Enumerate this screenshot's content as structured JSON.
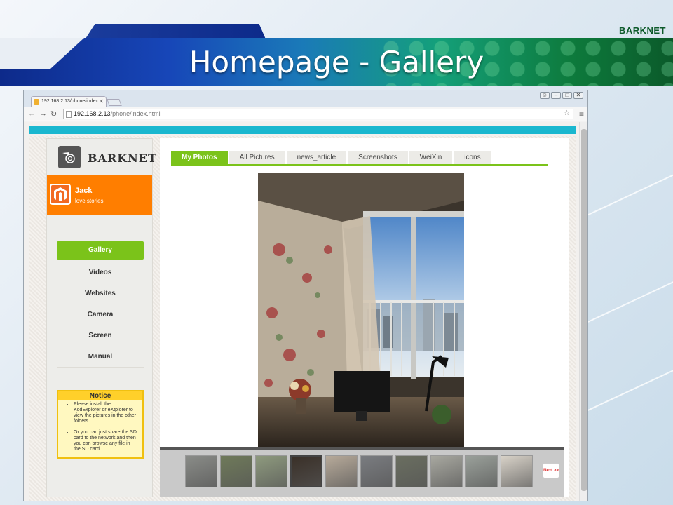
{
  "slide": {
    "title": "Homepage - Gallery",
    "brand": "BARKNET"
  },
  "browser": {
    "tab_title": "192.168.2.13/phone/index",
    "url_host": "192.168.2.13",
    "url_path": "/phone/index.html"
  },
  "site": {
    "logo_text": "BARKNET",
    "user": {
      "name": "Jack",
      "motto": "love stories"
    },
    "menu": [
      {
        "label": "Gallery",
        "active": true
      },
      {
        "label": "Videos",
        "active": false
      },
      {
        "label": "Websites",
        "active": false
      },
      {
        "label": "Camera",
        "active": false
      },
      {
        "label": "Screen",
        "active": false
      },
      {
        "label": "Manual",
        "active": false
      }
    ],
    "notice": {
      "title": "Notice",
      "items": [
        "Please install the KodExplorer or eXtplorer to view the pictures in the other folders.",
        "Or you can just share the SD card to the network and then you can browse any file in the SD card."
      ]
    }
  },
  "gallery": {
    "tabs": [
      "My Photos",
      "All Pictures",
      "news_article",
      "Screenshots",
      "WeiXin",
      "icons"
    ],
    "active_tab": 0,
    "thumbnail_colors": [
      "#8a8c88",
      "#6f7a5a",
      "#8e9a7e",
      "#3a3028",
      "#b7aa9a",
      "#7a7c80",
      "#6a6e60",
      "#a8a8a0",
      "#9aa09a",
      "#d8d2c8"
    ],
    "active_thumb": 3,
    "next_label": "Next >>"
  },
  "colors": {
    "accent_green": "#7bc31a",
    "user_orange": "#ff7e00",
    "cyan_bar": "#1ab7cf"
  }
}
